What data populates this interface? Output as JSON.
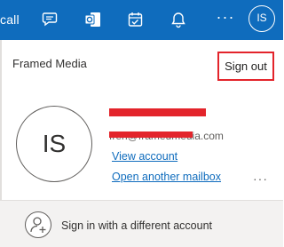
{
  "topbar": {
    "call_fragment": "call",
    "background": "#0f6cbd",
    "icons": [
      "chat-icon",
      "office-icon",
      "calendar-check-icon",
      "bell-icon",
      "more-icon"
    ],
    "more_label": "···",
    "avatar_initials": "IS"
  },
  "account_panel": {
    "organization": "Framed Media",
    "sign_out_label": "Sign out",
    "avatar_initials": "IS",
    "email_visible_fragment": "fren@framedmedia.com",
    "view_account_label": "View account",
    "open_mailbox_label": "Open another mailbox",
    "more_options_label": "···",
    "sign_in_other_label": "Sign in with a different account",
    "highlight_color": "#e3242b",
    "link_color": "#0f6cbd"
  }
}
